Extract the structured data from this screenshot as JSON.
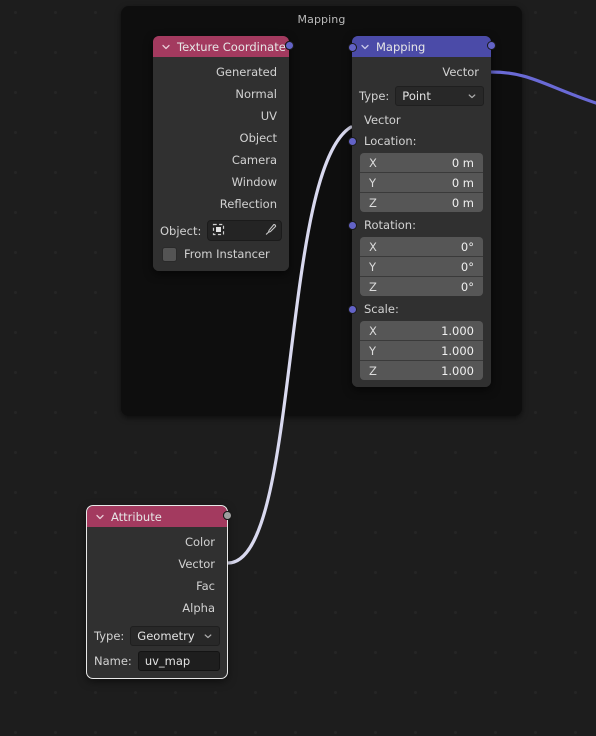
{
  "editor": {
    "frame": {
      "label": "Mapping"
    }
  },
  "nodes": {
    "texture_coordinate": {
      "title": "Texture Coordinate",
      "header_color": "#a33a5f",
      "outputs": [
        {
          "label": "Generated",
          "type": "vector"
        },
        {
          "label": "Normal",
          "type": "vector"
        },
        {
          "label": "UV",
          "type": "vector"
        },
        {
          "label": "Object",
          "type": "vector"
        },
        {
          "label": "Camera",
          "type": "vector"
        },
        {
          "label": "Window",
          "type": "vector"
        },
        {
          "label": "Reflection",
          "type": "vector"
        }
      ],
      "object_label": "Object:",
      "object_value": "",
      "from_instancer_label": "From Instancer",
      "from_instancer_checked": false
    },
    "mapping": {
      "title": "Mapping",
      "header_color": "#4b4ba8",
      "output_vector_label": "Vector",
      "type_label": "Type:",
      "type_value": "Point",
      "input_vector_label": "Vector",
      "location_label": "Location:",
      "location": [
        {
          "axis": "X",
          "value": "0 m"
        },
        {
          "axis": "Y",
          "value": "0 m"
        },
        {
          "axis": "Z",
          "value": "0 m"
        }
      ],
      "rotation_label": "Rotation:",
      "rotation": [
        {
          "axis": "X",
          "value": "0°"
        },
        {
          "axis": "Y",
          "value": "0°"
        },
        {
          "axis": "Z",
          "value": "0°"
        }
      ],
      "scale_label": "Scale:",
      "scale": [
        {
          "axis": "X",
          "value": "1.000"
        },
        {
          "axis": "Y",
          "value": "1.000"
        },
        {
          "axis": "Z",
          "value": "1.000"
        }
      ]
    },
    "attribute": {
      "title": "Attribute",
      "header_color": "#a33a5f",
      "outputs": [
        {
          "label": "Color",
          "type": "color"
        },
        {
          "label": "Vector",
          "type": "vector"
        },
        {
          "label": "Fac",
          "type": "float"
        },
        {
          "label": "Alpha",
          "type": "float"
        }
      ],
      "type_label": "Type:",
      "type_value": "Geometry",
      "name_label": "Name:",
      "name_value": "uv_map"
    }
  },
  "links": [
    {
      "from": "attribute.Vector",
      "to": "mapping.Vector",
      "color": "#d8d8ee",
      "selected": true
    },
    {
      "from": "mapping.Vector",
      "to": "offscreen",
      "color": "#6363d8",
      "selected": false
    }
  ]
}
